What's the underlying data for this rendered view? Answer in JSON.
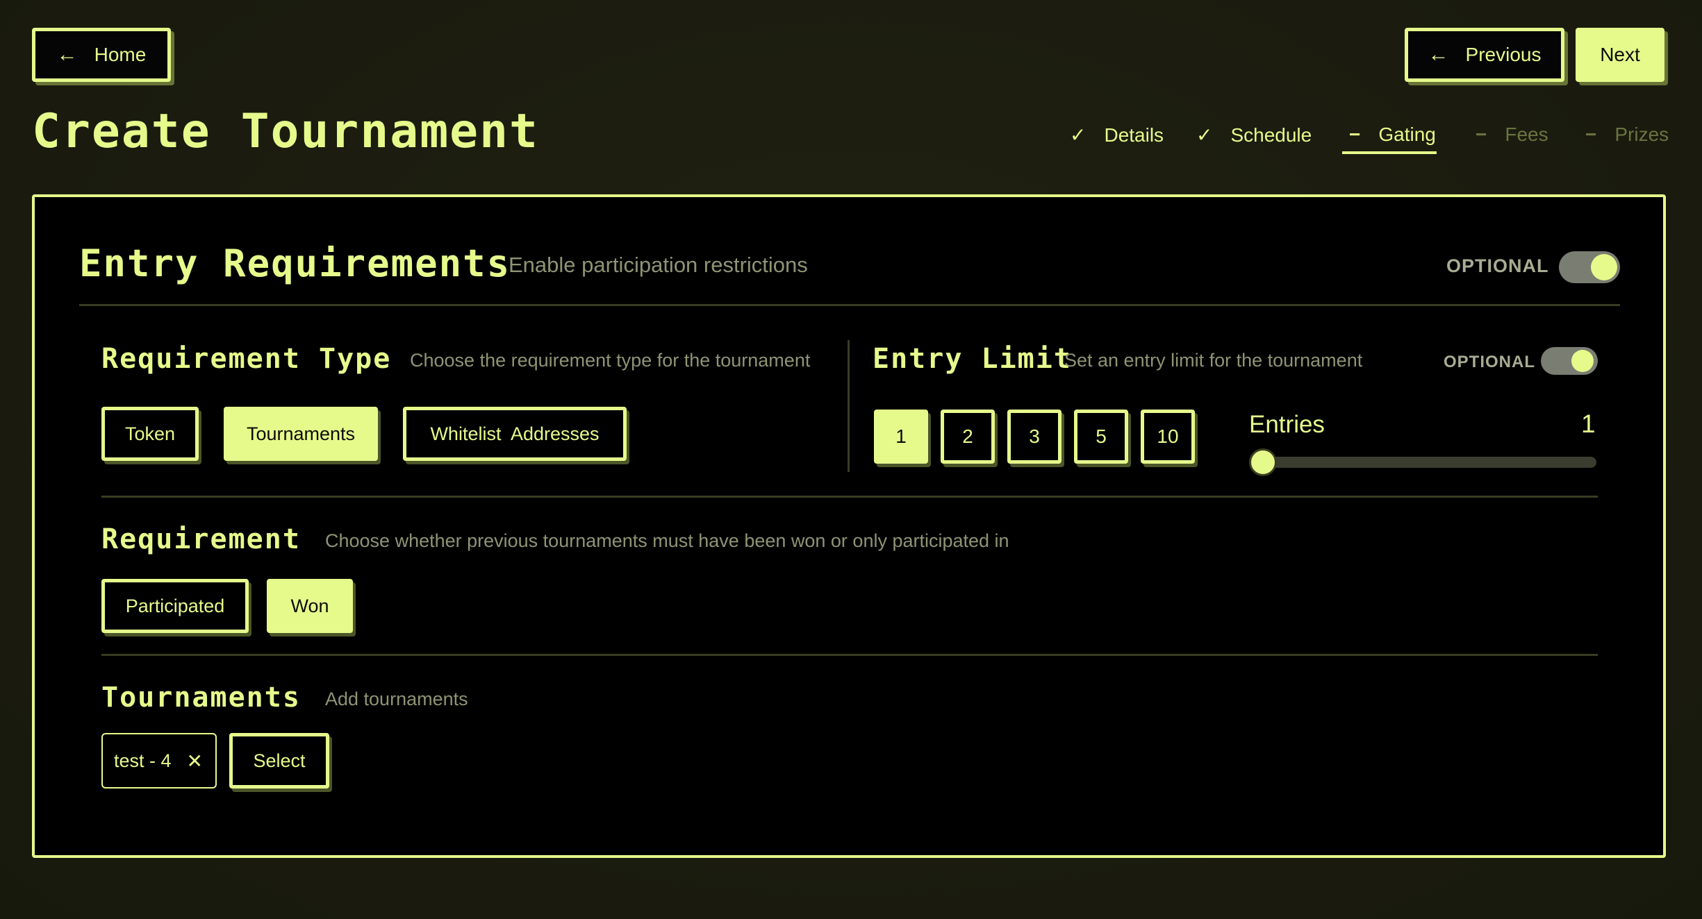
{
  "nav": {
    "home_label": "Home",
    "previous_label": "Previous",
    "next_label": "Next"
  },
  "page": {
    "title": "Create Tournament"
  },
  "steps": [
    {
      "label": "Details",
      "state": "done"
    },
    {
      "label": "Schedule",
      "state": "done"
    },
    {
      "label": "Gating",
      "state": "active"
    },
    {
      "label": "Fees",
      "state": "pending"
    },
    {
      "label": "Prizes",
      "state": "pending"
    }
  ],
  "entry_requirements": {
    "title": "Entry Requirements",
    "subtitle": "Enable participation restrictions",
    "optional_label": "OPTIONAL",
    "enabled": true
  },
  "requirement_type": {
    "title": "Requirement Type",
    "subtitle": "Choose the requirement type for the tournament",
    "options": [
      "Token",
      "Tournaments",
      "Whitelist  Addresses"
    ],
    "selected": "Tournaments"
  },
  "entry_limit": {
    "title": "Entry Limit",
    "subtitle": "Set an entry limit for the tournament",
    "optional_label": "OPTIONAL",
    "enabled": true,
    "presets": [
      "1",
      "2",
      "3",
      "5",
      "10"
    ],
    "selected": "1",
    "entries_label": "Entries",
    "entries_value": "1"
  },
  "requirement": {
    "title": "Requirement",
    "subtitle": "Choose whether previous tournaments must have been won or only participated in",
    "options": [
      "Participated",
      "Won"
    ],
    "selected": "Won"
  },
  "tournaments": {
    "title": "Tournaments",
    "subtitle": "Add tournaments",
    "chips": [
      "test - 4"
    ],
    "select_label": "Select"
  },
  "colors": {
    "accent": "#e6fa8c",
    "panel_bg": "#000000",
    "page_bg": "#1d1e10",
    "muted": "#8e9474"
  },
  "icons": {
    "back": "arrow-left-icon",
    "done": "check-icon",
    "active": "dash-icon",
    "pending": "dash-icon",
    "remove": "close-icon"
  }
}
